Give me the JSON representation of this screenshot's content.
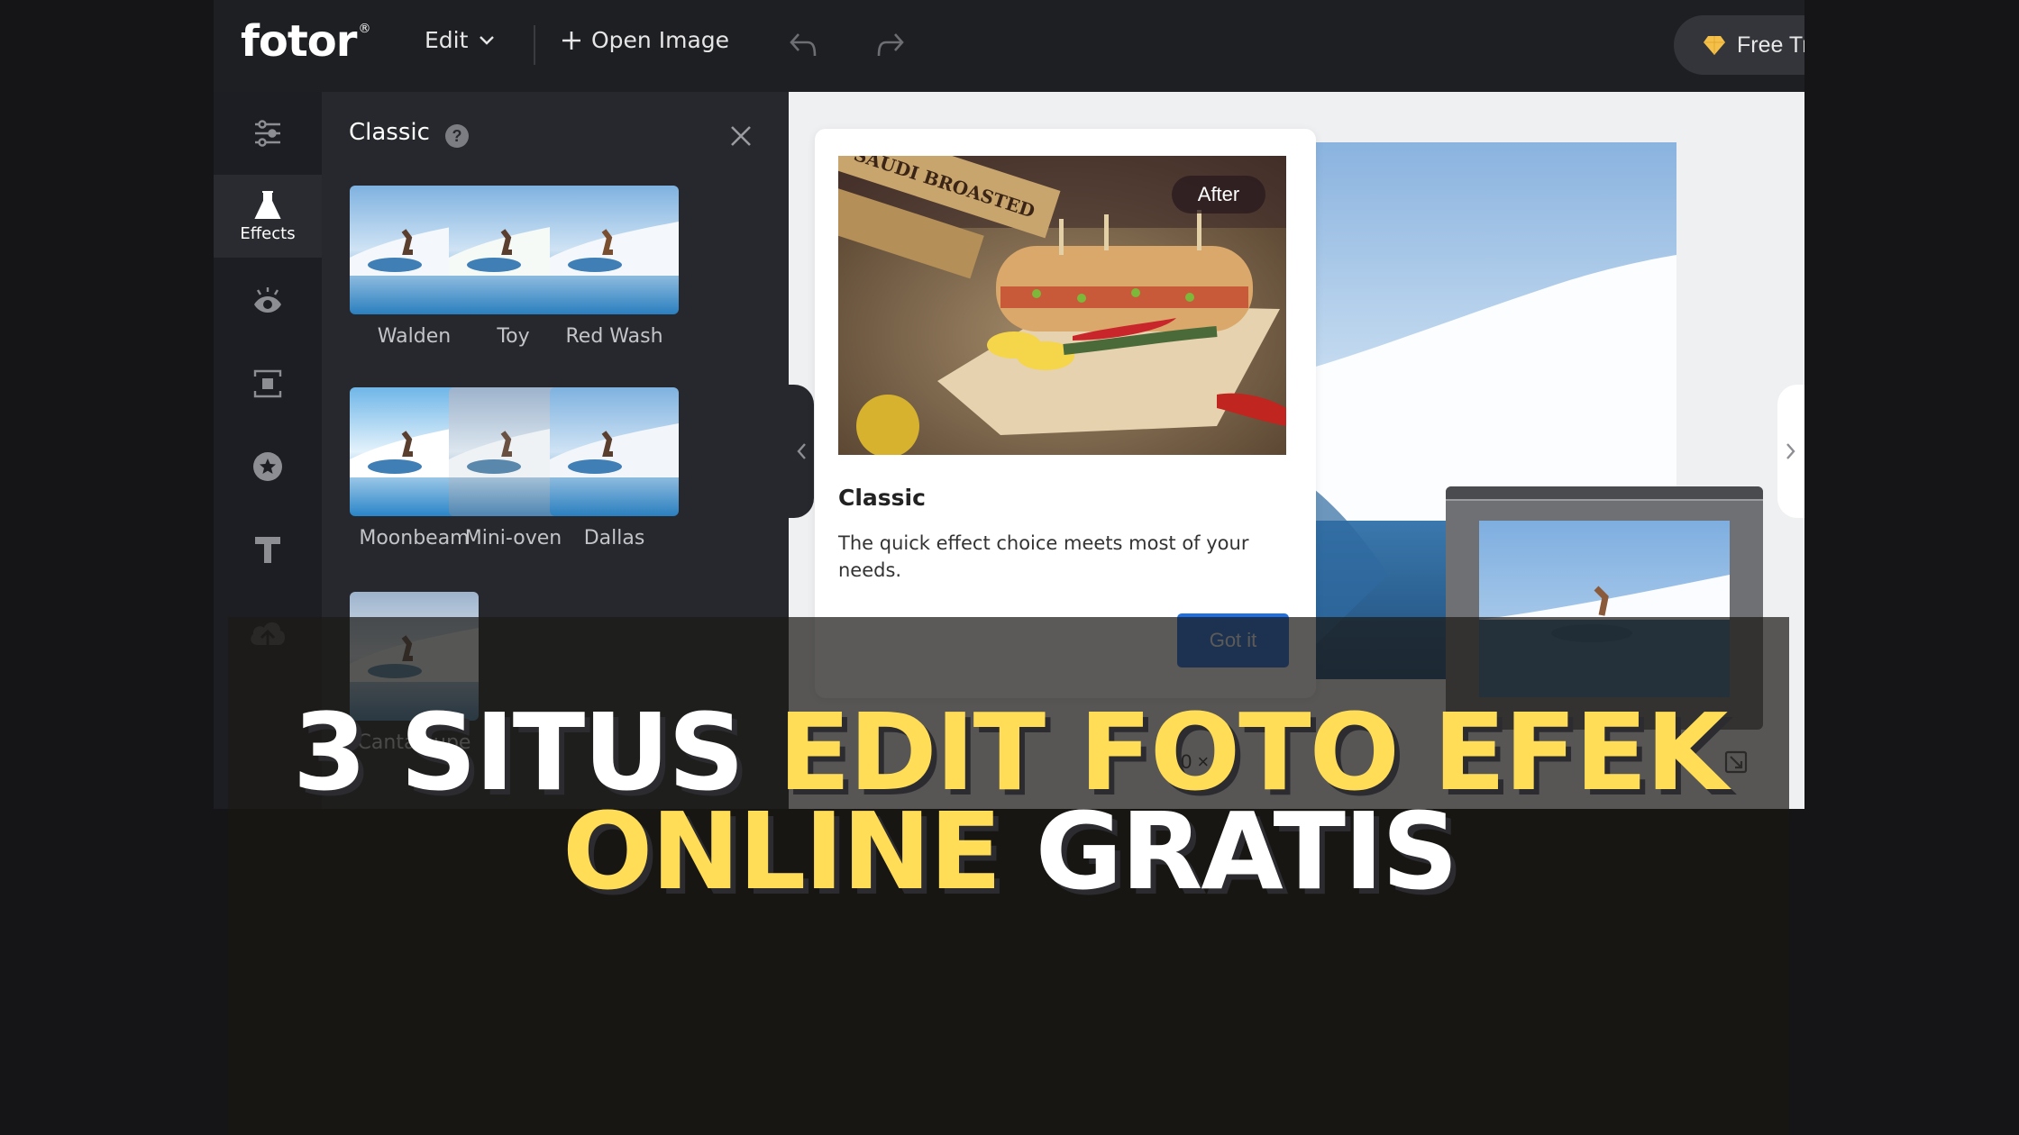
{
  "app": {
    "logo": "fotor",
    "logo_mark": "®",
    "menu": {
      "edit_label": "Edit",
      "open_image_label": "Open Image"
    },
    "free_trial_label": "Free Tr",
    "colors": {
      "accent_blue": "#1f6fe0",
      "trial_gem": "#f4c04a",
      "headline_yellow": "#ffdd57"
    }
  },
  "leftnav": {
    "items": [
      {
        "name": "adjust",
        "icon": "sliders-icon",
        "label": ""
      },
      {
        "name": "effects",
        "icon": "flask-icon",
        "label": "Effects",
        "active": true
      },
      {
        "name": "beauty",
        "icon": "eye-icon",
        "label": ""
      },
      {
        "name": "frames",
        "icon": "frame-icon",
        "label": ""
      },
      {
        "name": "stickers",
        "icon": "star-circle-icon",
        "label": ""
      },
      {
        "name": "text",
        "icon": "text-icon",
        "label": ""
      },
      {
        "name": "upload",
        "icon": "cloud-upload-icon",
        "label": ""
      }
    ]
  },
  "panel": {
    "title": "Classic",
    "effects": [
      {
        "label": "Walden"
      },
      {
        "label": "Toy"
      },
      {
        "label": "Red Wash"
      },
      {
        "label": "Moonbeam"
      },
      {
        "label": "Mini-oven"
      },
      {
        "label": "Dallas"
      },
      {
        "label": "Cantaloupe"
      }
    ]
  },
  "tip": {
    "badge": "After",
    "title": "Classic",
    "description": "The quick effect choice meets most of your needs.",
    "button": "Got it"
  },
  "canvas": {
    "size_readout": "0 × 39"
  },
  "headline": {
    "line1_white": "3 SITUS",
    "line1_yellow": "EDIT FOTO EFEK",
    "line2_yellow": "ONLINE",
    "line2_white": "GRATIS"
  }
}
